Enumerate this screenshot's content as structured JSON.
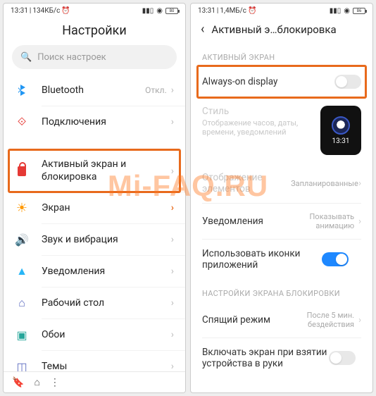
{
  "watermark": "Mi-FAQ.RU",
  "left": {
    "status": {
      "time": "13:31",
      "net": "134КБ/с",
      "batt": "80"
    },
    "title": "Настройки",
    "search_placeholder": "Поиск настроек",
    "items": [
      {
        "icon": "bluetooth-icon",
        "label": "Bluetooth",
        "value": "Откл."
      },
      {
        "icon": "connections-icon",
        "label": "Подключения",
        "value": ""
      },
      {
        "icon": "lock-icon",
        "label": "Активный экран и блокировка",
        "value": "",
        "highlight": true
      },
      {
        "icon": "display-icon",
        "label": "Экран",
        "value": ""
      },
      {
        "icon": "sound-icon",
        "label": "Звук и вибрация",
        "value": ""
      },
      {
        "icon": "notifications-icon",
        "label": "Уведомления",
        "value": ""
      },
      {
        "icon": "home-icon",
        "label": "Рабочий стол",
        "value": ""
      },
      {
        "icon": "wallpaper-icon",
        "label": "Обои",
        "value": ""
      },
      {
        "icon": "themes-icon",
        "label": "Темы",
        "value": ""
      }
    ]
  },
  "right": {
    "status": {
      "time": "13:31",
      "net": "1,4МБ/с",
      "batt": "86"
    },
    "title": "Активный э…блокировка",
    "section1": "АКТИВНЫЙ ЭКРАН",
    "aod": {
      "label": "Always-on display",
      "on": false,
      "highlight": true
    },
    "style": {
      "label": "Стиль",
      "sub": "Отображение часов, даты, времени, уведомлений",
      "time": "13:31"
    },
    "display_items": {
      "label": "Отображение элементов",
      "value": "Запланированные"
    },
    "notifications": {
      "label": "Уведомления",
      "value": "Показывать анимацию"
    },
    "app_icons": {
      "label": "Использовать иконки приложений",
      "on": true
    },
    "section2": "НАСТРОЙКИ ЭКРАНА БЛОКИРОВКИ",
    "sleep": {
      "label": "Спящий режим",
      "value": "После 5 мин. бездействия"
    },
    "raise": {
      "label": "Включать экран при взятии устройства в руки",
      "on": false
    }
  }
}
